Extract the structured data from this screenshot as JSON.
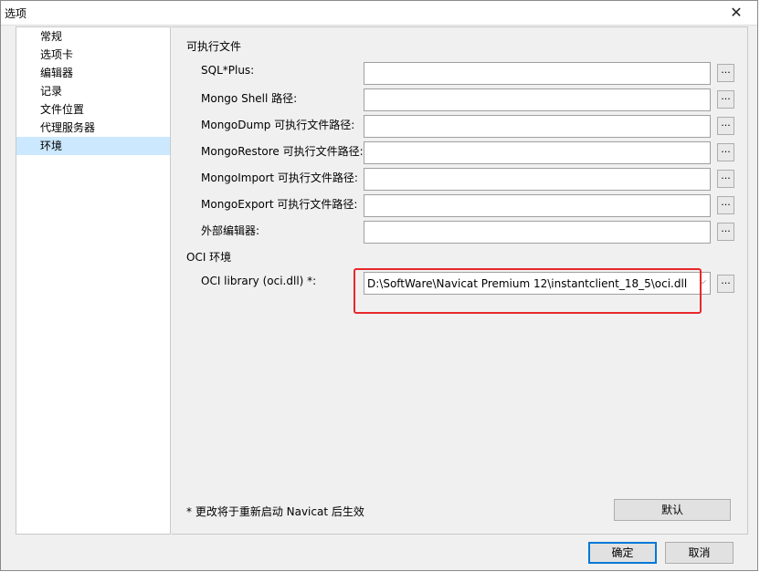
{
  "window": {
    "title": "选项",
    "close_glyph": "✕"
  },
  "sidebar": {
    "items": [
      {
        "label": "常规",
        "selected": false
      },
      {
        "label": "选项卡",
        "selected": false
      },
      {
        "label": "编辑器",
        "selected": false
      },
      {
        "label": "记录",
        "selected": false
      },
      {
        "label": "文件位置",
        "selected": false
      },
      {
        "label": "代理服务器",
        "selected": false
      },
      {
        "label": "环境",
        "selected": true
      }
    ]
  },
  "executables": {
    "section_title": "可执行文件",
    "rows": [
      {
        "label": "SQL*Plus:",
        "value": "",
        "browse": "..."
      },
      {
        "label": "Mongo Shell 路径:",
        "value": "",
        "browse": "..."
      },
      {
        "label": "MongoDump 可执行文件路径:",
        "value": "",
        "browse": "..."
      },
      {
        "label": "MongoRestore 可执行文件路径:",
        "value": "",
        "browse": "..."
      },
      {
        "label": "MongoImport 可执行文件路径:",
        "value": "",
        "browse": "..."
      },
      {
        "label": "MongoExport 可执行文件路径:",
        "value": "",
        "browse": "..."
      },
      {
        "label": "外部编辑器:",
        "value": "",
        "browse": "..."
      }
    ]
  },
  "oci": {
    "section_title": "OCI 环境",
    "label": "OCI library (oci.dll) *:",
    "value": "D:\\SoftWare\\Navicat Premium 12\\instantclient_18_5\\oci.dll",
    "browse": "..."
  },
  "footer": {
    "note": "* 更改将于重新启动 Navicat 后生效",
    "default_button": "默认",
    "ok_button": "确定",
    "cancel_button": "取消"
  },
  "colors": {
    "selected_bg": "#cce8ff",
    "highlight_border": "#e8282b",
    "default_button_border": "#0078d7"
  }
}
